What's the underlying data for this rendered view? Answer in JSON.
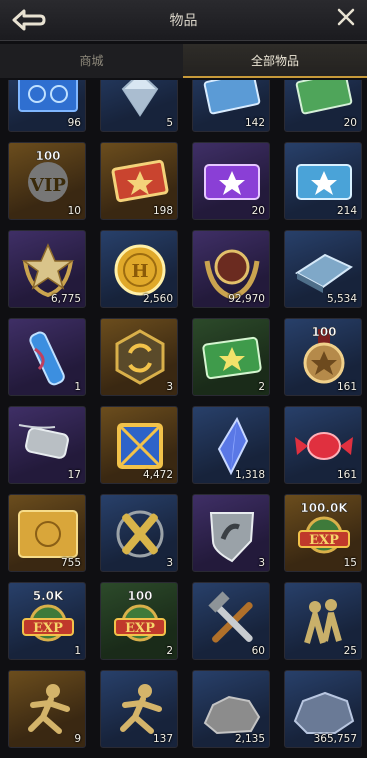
{
  "header": {
    "title": "物品"
  },
  "tabs": [
    {
      "label": "商城"
    },
    {
      "label": "全部物品"
    }
  ],
  "items": [
    {
      "icon": "blueprint-icon",
      "qty": "96",
      "rarity": "blue"
    },
    {
      "icon": "diamond-icon",
      "qty": "5",
      "rarity": "blue"
    },
    {
      "icon": "blue-ticket-icon",
      "qty": "142",
      "rarity": "blue"
    },
    {
      "icon": "green-ticket-icon",
      "qty": "20",
      "rarity": "blue"
    },
    {
      "icon": "vip-card-icon",
      "label": "100",
      "badge": "VIP",
      "qty": "10",
      "rarity": "gold"
    },
    {
      "icon": "gold-ticket-icon",
      "qty": "198",
      "rarity": "gold"
    },
    {
      "icon": "purple-star-ticket-icon",
      "qty": "20",
      "rarity": "purple"
    },
    {
      "icon": "blue-star-ticket-icon",
      "qty": "214",
      "rarity": "blue"
    },
    {
      "icon": "rank-badge-icon",
      "qty": "6,775",
      "rarity": "purple"
    },
    {
      "icon": "gold-coin-icon",
      "badge": "H",
      "qty": "2,560",
      "rarity": "blue"
    },
    {
      "icon": "laurel-medal-icon",
      "qty": "92,970",
      "rarity": "purple"
    },
    {
      "icon": "steel-plate-icon",
      "qty": "5,534",
      "rarity": "blue"
    },
    {
      "icon": "scroll-icon",
      "qty": "1",
      "rarity": "purple"
    },
    {
      "icon": "refresh-emblem-icon",
      "qty": "3",
      "rarity": "gold"
    },
    {
      "icon": "green-star-ticket-icon",
      "qty": "2",
      "rarity": "green"
    },
    {
      "icon": "star-medal-icon",
      "label": "100",
      "qty": "161",
      "rarity": "blue"
    },
    {
      "icon": "dog-tag-icon",
      "qty": "17",
      "rarity": "purple"
    },
    {
      "icon": "blue-crate-icon",
      "qty": "4,472",
      "rarity": "gold"
    },
    {
      "icon": "crystal-icon",
      "qty": "1,318",
      "rarity": "blue"
    },
    {
      "icon": "candy-icon",
      "qty": "161",
      "rarity": "blue"
    },
    {
      "icon": "gold-map-icon",
      "qty": "755",
      "rarity": "gold"
    },
    {
      "icon": "crossed-shells-icon",
      "qty": "3",
      "rarity": "blue"
    },
    {
      "icon": "arm-shield-icon",
      "qty": "3",
      "rarity": "purple"
    },
    {
      "icon": "exp-badge-icon",
      "label": "100.0K",
      "badge": "EXP",
      "qty": "15",
      "rarity": "gold"
    },
    {
      "icon": "exp-badge-icon",
      "label": "5.0K",
      "badge": "EXP",
      "qty": "1",
      "rarity": "blue"
    },
    {
      "icon": "exp-badge-icon",
      "label": "100",
      "badge": "EXP",
      "qty": "2",
      "rarity": "green"
    },
    {
      "icon": "tools-icon",
      "qty": "60",
      "rarity": "blue"
    },
    {
      "icon": "soldiers-icon",
      "qty": "25",
      "rarity": "blue"
    },
    {
      "icon": "soldier-run-icon",
      "qty": "9",
      "rarity": "gold"
    },
    {
      "icon": "soldier-run-icon",
      "qty": "137",
      "rarity": "blue"
    },
    {
      "icon": "stone-icon",
      "qty": "2,135",
      "rarity": "blue"
    },
    {
      "icon": "ore-icon",
      "qty": "365,757",
      "rarity": "blue"
    }
  ]
}
